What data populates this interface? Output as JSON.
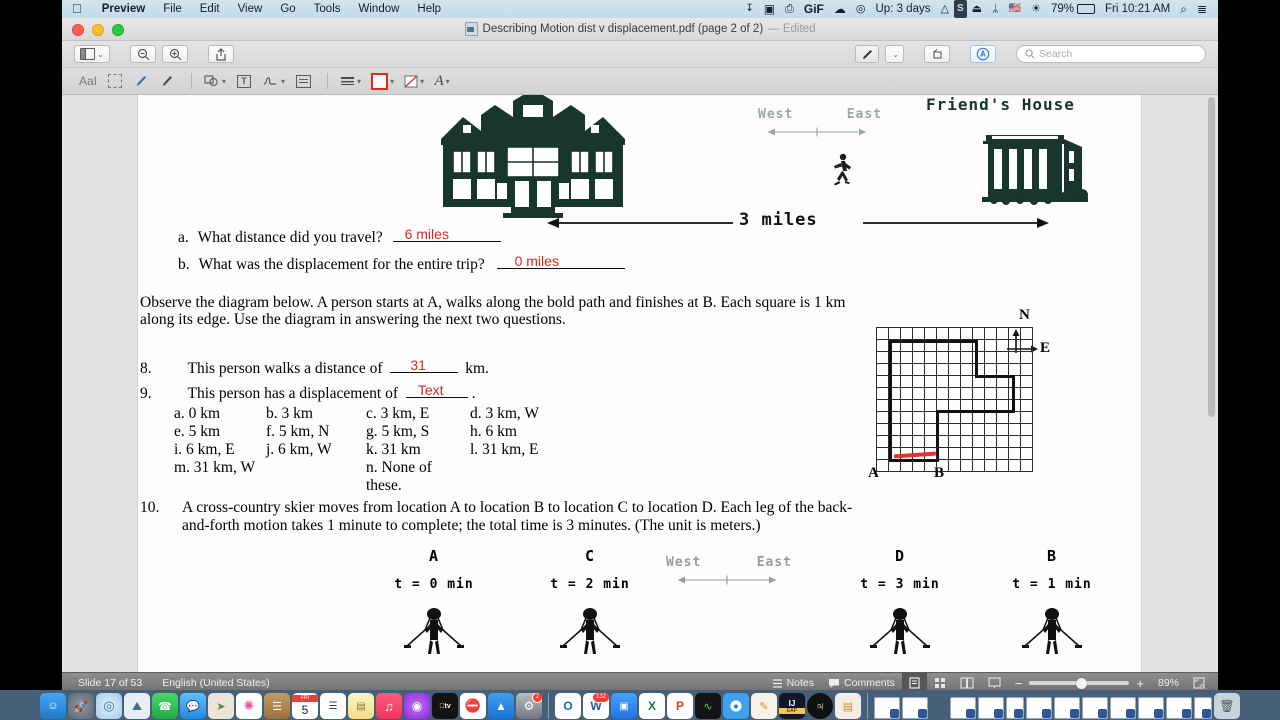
{
  "menubar": {
    "apple": "apple-logo",
    "items": [
      {
        "label": "Preview",
        "bold": true
      },
      {
        "label": "File",
        "bold": false
      },
      {
        "label": "Edit",
        "bold": false
      },
      {
        "label": "View",
        "bold": false
      },
      {
        "label": "Go",
        "bold": false
      },
      {
        "label": "Tools",
        "bold": false
      },
      {
        "label": "Window",
        "bold": false
      },
      {
        "label": "Help",
        "bold": false
      }
    ],
    "status_items": [
      {
        "name": "microphone-icon",
        "glyph": "⬇",
        "text": ""
      },
      {
        "name": "screen-recorder-icon",
        "glyph": "▣",
        "text": ""
      },
      {
        "name": "printer-icon",
        "glyph": "⎙",
        "text": ""
      },
      {
        "name": "gif-capture-icon",
        "glyph": "GiF",
        "text": ""
      },
      {
        "name": "cloud-icon",
        "glyph": "☁",
        "text": ""
      },
      {
        "name": "dropbox-icon",
        "glyph": "◎",
        "text": ""
      },
      {
        "name": "uptime-indicator",
        "glyph": "",
        "text": "Up: 3 days"
      },
      {
        "name": "drive-icon",
        "glyph": "△",
        "text": ""
      },
      {
        "name": "shortcuts-icon",
        "glyph": "S",
        "text": ""
      },
      {
        "name": "airplay-icon",
        "glyph": "▭",
        "text": ""
      },
      {
        "name": "bluetooth-icon",
        "glyph": "ᛦ",
        "text": ""
      },
      {
        "name": "input-language-flag",
        "glyph": "☰",
        "text": ""
      },
      {
        "name": "wifi-icon",
        "glyph": "◠",
        "text": ""
      },
      {
        "name": "battery-indicator",
        "glyph": "▭",
        "text": "79%"
      },
      {
        "name": "clock",
        "glyph": "",
        "text": "Fri 10:21 AM"
      },
      {
        "name": "spotlight-search-icon",
        "glyph": "⌕",
        "text": ""
      },
      {
        "name": "control-center-icon",
        "glyph": "≡",
        "text": ""
      }
    ]
  },
  "window": {
    "title": "Describing Motion dist v displacement.pdf (page 2 of 2)",
    "title_suffix": "— Edited",
    "traffic_lights": [
      "close-button",
      "minimize-button",
      "maximize-button"
    ]
  },
  "toolbar": {
    "sidebar_button": "sidebar-toggle",
    "sidebar_chevron": "⌄",
    "zoom_out_label": "⊖",
    "zoom_in_label": "⊕",
    "share_label": "⇧",
    "markup_toggle_label": "✐",
    "markup_chevron": "⌄",
    "rotate_label": "↻",
    "annotate_label": "Ⓐ",
    "search_placeholder": "Search",
    "search_icon": "⌕"
  },
  "markup_toolbar": {
    "items": [
      {
        "name": "text-selection-tool",
        "label": "AaI",
        "chevron": false
      },
      {
        "name": "rectangular-selection-tool",
        "label": "⬚",
        "chevron": false
      },
      {
        "name": "instant-alpha-tool",
        "label": "✎",
        "chevron": false
      },
      {
        "name": "sketch-tool",
        "label": "✒",
        "chevron": false
      },
      {
        "name": "shapes-tool",
        "label": "⬡",
        "chevron": true
      },
      {
        "name": "text-tool",
        "label": "T",
        "chevron": false
      },
      {
        "name": "sign-tool",
        "label": "✍",
        "chevron": true
      },
      {
        "name": "note-tool",
        "label": "▤",
        "chevron": false
      },
      {
        "name": "shape-style-tool",
        "label": "≡",
        "chevron": true
      },
      {
        "name": "border-color-tool",
        "label": "■",
        "chevron": true
      },
      {
        "name": "fill-color-tool",
        "label": "◧",
        "chevron": true
      },
      {
        "name": "text-style-tool",
        "label": "A",
        "chevron": true
      }
    ]
  },
  "document": {
    "top_figure": {
      "friends_house_label": "Friend's House",
      "west_label": "West",
      "east_label": "East",
      "distance_label": "3 miles",
      "home_house": "victorian-house-illustration",
      "friend_house": "apartment-house-illustration",
      "runner": "running-person-icon"
    },
    "question_a": {
      "marker": "a.",
      "text": "What distance did you travel?",
      "answer": "6 miles"
    },
    "question_b": {
      "marker": "b.",
      "text": "What was the displacement for the entire trip?",
      "answer": "0 miles"
    },
    "observe_paragraph": "Observe the diagram below.  A person starts at A, walks along the bold path and finishes at B.  Each square is 1 km along its edge.  Use the diagram in answering the next two questions.",
    "question_8": {
      "number": "8.",
      "text_before": "This person walks a distance of",
      "answer": "31",
      "text_after": "km."
    },
    "question_9": {
      "number": "9.",
      "text_before": "This person has a displacement of",
      "answer": "Text",
      "text_after": ".",
      "choices": [
        [
          "a.  0 km",
          "b.  3 km",
          "c.  3 km, E",
          "d.  3 km, W"
        ],
        [
          "e.  5 km",
          "f.  5 km, N",
          "g.  5 km, S",
          "h.  6 km"
        ],
        [
          "i.  6 km, E",
          "j.  6 km, W",
          "k.  31 km",
          "l.  31 km, E"
        ],
        [
          "m.  31 km, W",
          "",
          "n.  None of these.",
          ""
        ]
      ]
    },
    "grid_figure": {
      "start_label": "A",
      "end_label": "B",
      "north_label": "N",
      "east_label": "E",
      "cols": 13,
      "rows": 12
    },
    "question_10": {
      "number": "10.",
      "line1": "A cross-country skier moves from location A to location B to location C to location D.  Each leg of the back-",
      "line2": "and-forth motion takes 1 minute to complete;  the total time is 3 minutes.  (The unit is meters.)"
    },
    "skier_figure": {
      "west_label": "West",
      "east_label": "East",
      "points": [
        {
          "label": "A",
          "time": "t = 0 min"
        },
        {
          "label": "C",
          "time": "t = 2 min"
        },
        {
          "label": "D",
          "time": "t = 3 min"
        },
        {
          "label": "B",
          "time": "t = 1 min"
        }
      ]
    }
  },
  "statusbar": {
    "slide": "Slide 17 of 53",
    "language": "English (United States)",
    "notes_label": "Notes",
    "notes_icon": "☰",
    "comments_label": "Comments",
    "comments_icon": "▣",
    "view_single_icon": "▤",
    "view_grid_icon": "⬚",
    "view_book_icon": "◫",
    "view_present_icon": "▭",
    "zoom_out": "−",
    "zoom_in": "+",
    "zoom_level": "89%",
    "fit_icon": "⛶"
  },
  "dock": {
    "left_apps": [
      {
        "name": "finder",
        "glyph": "🙂",
        "color": "#2d8cf0",
        "running": true
      },
      {
        "name": "launchpad",
        "glyph": "🚀",
        "color": "#6e7a85",
        "running": false
      },
      {
        "name": "safari",
        "glyph": "◎",
        "color": "#1a8cff",
        "running": true
      },
      {
        "name": "photos-preview",
        "glyph": "⛰",
        "color": "#dbe5ee",
        "running": false
      },
      {
        "name": "facetime",
        "glyph": "▶",
        "color": "#34c759",
        "running": true
      },
      {
        "name": "messages",
        "glyph": "…",
        "color": "#3eb2ff",
        "running": false
      },
      {
        "name": "maps",
        "glyph": "➤",
        "color": "#e9e3d7",
        "running": false
      },
      {
        "name": "photos",
        "glyph": "❀",
        "color": "#ffffff",
        "running": true
      },
      {
        "name": "contacts",
        "glyph": "▤",
        "color": "#b08a52",
        "running": false
      },
      {
        "name": "calendar",
        "glyph": "5",
        "color": "#ffffff",
        "running": false
      },
      {
        "name": "reminders",
        "glyph": "☰",
        "color": "#ffffff",
        "running": false
      },
      {
        "name": "notes",
        "glyph": "▧",
        "color": "#ffe8a3",
        "running": false
      },
      {
        "name": "music",
        "glyph": "♪",
        "color": "#fb5c74",
        "running": true
      },
      {
        "name": "podcasts",
        "glyph": "◉",
        "color": "#a855f7",
        "running": false
      },
      {
        "name": "appletv",
        "glyph": "tv",
        "color": "#111111",
        "running": false
      },
      {
        "name": "news",
        "glyph": "N",
        "color": "#ff3b30",
        "running": false
      },
      {
        "name": "app-store",
        "glyph": "A",
        "color": "#1a8cff",
        "running": false
      },
      {
        "name": "system-preferences",
        "glyph": "⚙",
        "color": "#8e9398",
        "running": false,
        "badge": "2"
      },
      {
        "name": "outlook",
        "glyph": "O",
        "color": "#0f6cbd",
        "running": true
      },
      {
        "name": "word",
        "glyph": "W",
        "color": "#2b579a",
        "running": true,
        "badge": "132"
      },
      {
        "name": "zoom",
        "glyph": "▣",
        "color": "#2d8cff",
        "running": true
      },
      {
        "name": "excel",
        "glyph": "X",
        "color": "#217346",
        "running": true
      },
      {
        "name": "powerpoint",
        "glyph": "P",
        "color": "#d24726",
        "running": true
      },
      {
        "name": "activity-monitor",
        "glyph": "⌇",
        "color": "#1c1c1e",
        "running": true
      },
      {
        "name": "chrome",
        "glyph": "●",
        "color": "#ffffff",
        "running": true
      },
      {
        "name": "pages",
        "glyph": "✐",
        "color": "#f3efe6",
        "running": true
      },
      {
        "name": "intellij",
        "glyph": "IJ",
        "color": "#1b1b2b",
        "running": true
      },
      {
        "name": "typora",
        "glyph": "T",
        "color": "#111111",
        "running": true
      },
      {
        "name": "preview",
        "glyph": "▤",
        "color": "#e8a33d",
        "running": true
      }
    ],
    "minimized": [
      "preview-window",
      "word-document"
    ],
    "recent": [
      "doc-1",
      "doc-2",
      "doc-3",
      "doc-4",
      "doc-5",
      "doc-6",
      "doc-7",
      "doc-8",
      "doc-9",
      "doc-10"
    ],
    "trash": {
      "name": "trash",
      "glyph": "🗑"
    }
  }
}
